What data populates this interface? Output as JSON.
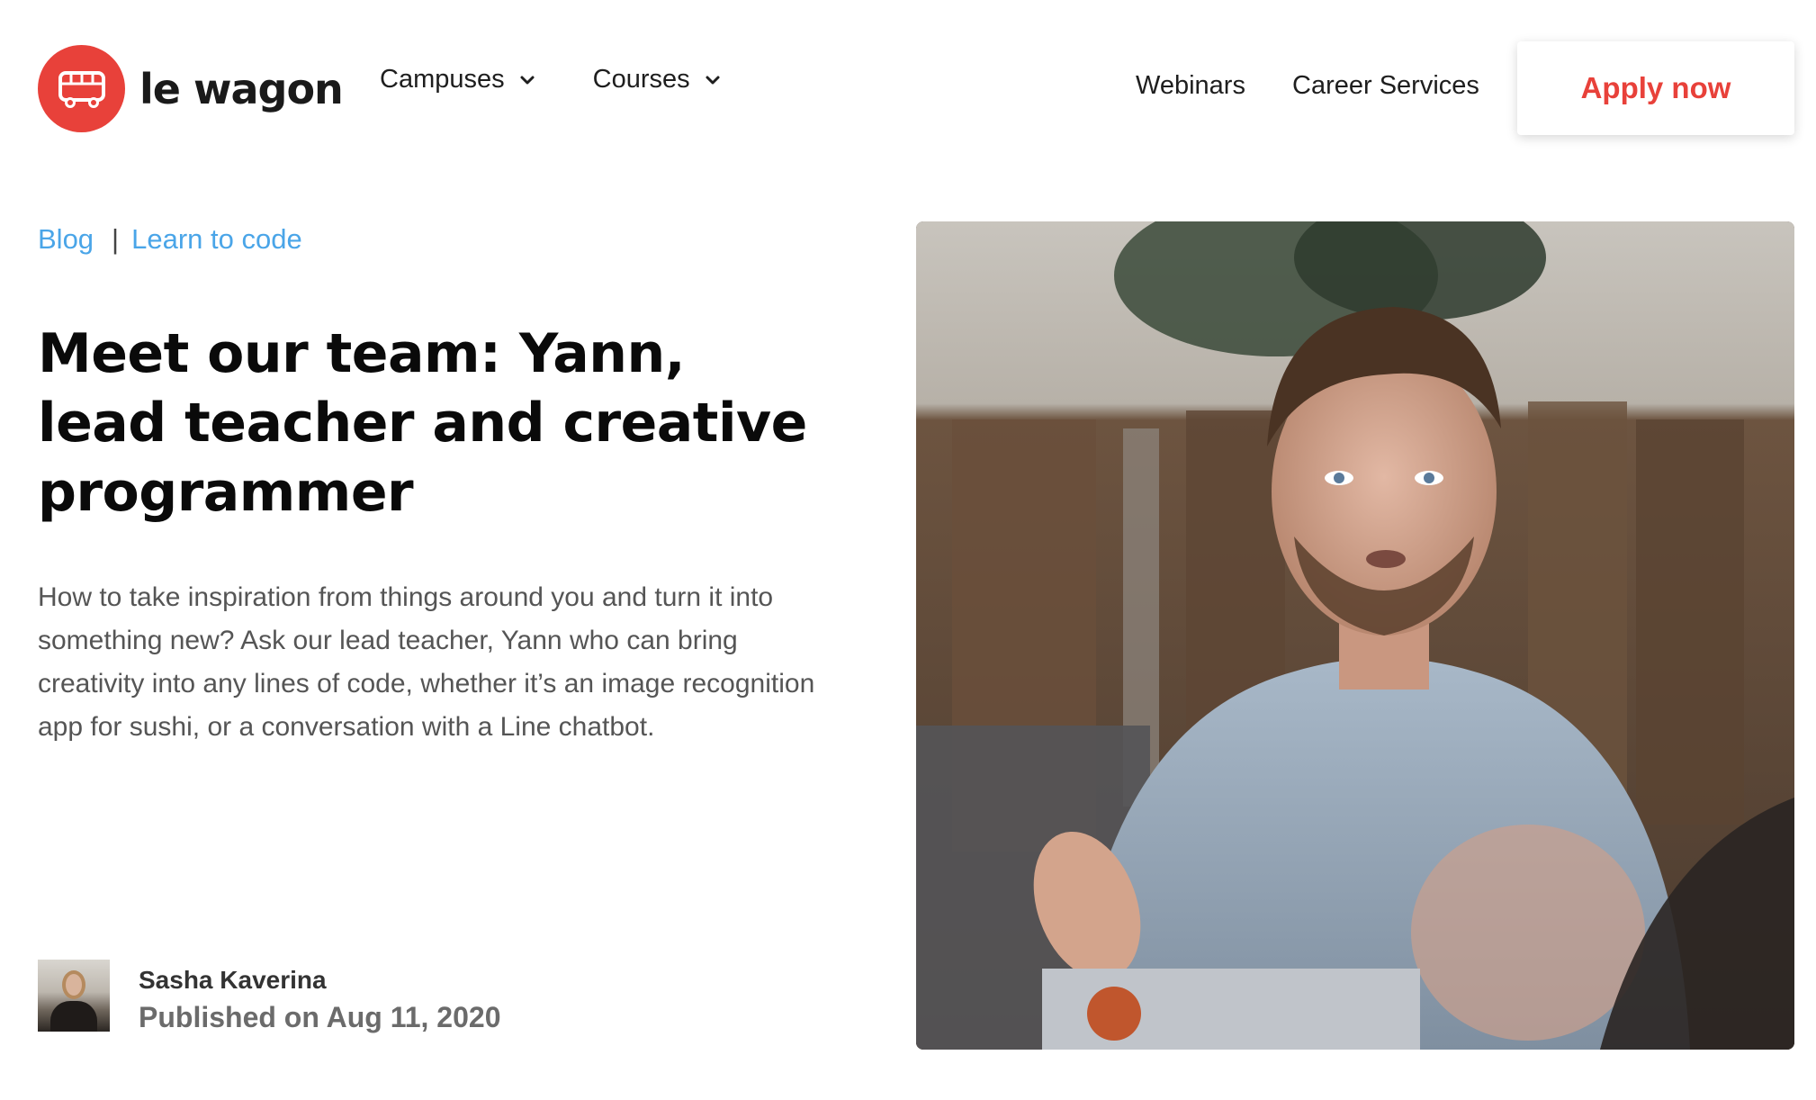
{
  "header": {
    "logo": {
      "text": "le wagon",
      "icon": "bus-icon",
      "color": "#e8413a"
    },
    "nav_left": [
      {
        "label": "Campuses",
        "icon": "chevron-down-icon"
      },
      {
        "label": "Courses",
        "icon": "chevron-down-icon"
      }
    ],
    "nav_right": [
      {
        "label": "Webinars"
      },
      {
        "label": "Career Services"
      }
    ],
    "cta": {
      "label": "Apply now",
      "color": "#e8413a"
    }
  },
  "breadcrumb": {
    "items": [
      "Blog",
      "Learn to code"
    ],
    "separator": "|",
    "color": "#4aa5e8"
  },
  "article": {
    "title": "Meet our team: Yann, lead teacher and creative programmer",
    "lede": "How to take inspiration from things around you and turn it into something new? Ask our lead teacher, Yann who can bring creativity into any lines of code, whether it’s an image recognition app for sushi, or a conversation with a Line chatbot.",
    "author": {
      "name": "Sasha Kaverina",
      "published": "Published on Aug 11, 2020"
    }
  }
}
